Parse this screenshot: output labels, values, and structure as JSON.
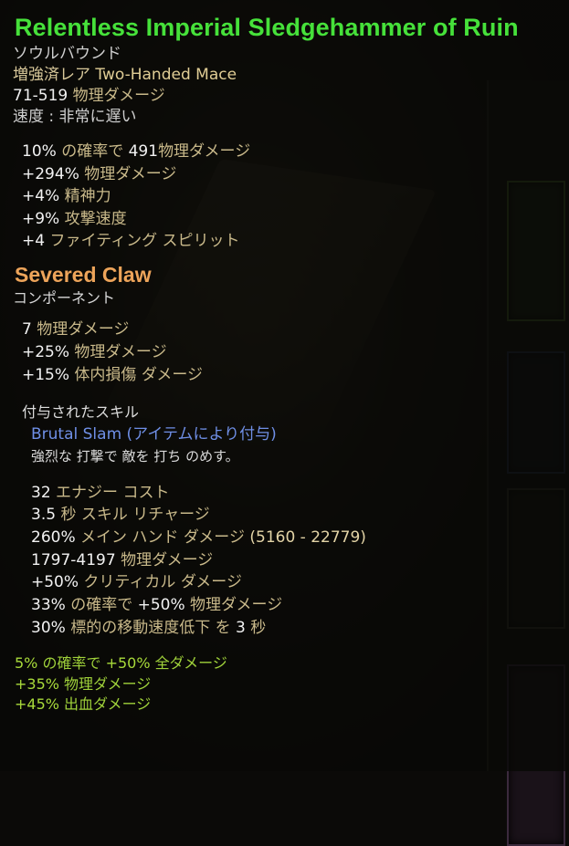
{
  "item": {
    "name": "Relentless Imperial Sledgehammer of Ruin",
    "binding": "ソウルバウンド",
    "type_prefix": "増強済レア",
    "type": "Two-Handed Mace",
    "damage_value": "71-519",
    "damage_label": "物理ダメージ",
    "speed": "速度 : 非常に遅い",
    "mods": [
      {
        "val": "10%",
        "pre": " の確率で ",
        "val2": "491",
        "lbl": "物理ダメージ"
      },
      {
        "val": "+294%",
        "lbl": " 物理ダメージ"
      },
      {
        "val": "+4%",
        "lbl": " 精神力"
      },
      {
        "val": "+9%",
        "lbl": " 攻撃速度"
      },
      {
        "val": "+4",
        "lbl": "  ファイティング スピリット"
      }
    ]
  },
  "component": {
    "name": "Severed Claw",
    "type": "コンポーネント",
    "mods": [
      {
        "val": "7",
        "lbl": " 物理ダメージ"
      },
      {
        "val": "+25%",
        "lbl": " 物理ダメージ"
      },
      {
        "val": "+15%",
        "lbl": " 体内損傷 ダメージ"
      }
    ]
  },
  "skill": {
    "header": "付与されたスキル",
    "name": "Brutal Slam (アイテムにより付与)",
    "description": "強烈な 打撃で 敵を 打ち のめす。",
    "stats": [
      {
        "val": "32",
        "lbl": " エナジー コスト"
      },
      {
        "val": "3.5",
        "lbl": " 秒 スキル リチャージ"
      },
      {
        "val": "260%",
        "lbl": " メイン ハンド ダメージ ",
        "val2": "(5160 - 22779)"
      },
      {
        "val": "1797-4197",
        "lbl": " 物理ダメージ"
      },
      {
        "val": "+50%",
        "lbl": " クリティカル ダメージ"
      },
      {
        "val": "33%",
        "lbl": " の確率で ",
        "val2": "+50%",
        "lbl2": " 物理ダメージ"
      },
      {
        "val": "30%",
        "lbl": " 標的の移動速度低下 を ",
        "val2": "3",
        "lbl2": " 秒"
      }
    ]
  },
  "set_bonus": [
    {
      "val": "5%",
      "lbl": " の確率で ",
      "val2": "+50%",
      "lbl2": " 全ダメージ"
    },
    {
      "val": "+35%",
      "lbl": " 物理ダメージ"
    },
    {
      "val": "+45%",
      "lbl": " 出血ダメージ"
    }
  ],
  "colors": {
    "item_name": "#46e13a",
    "component_name": "#eda45a",
    "skill_name": "#6f8fe6",
    "bonus_text": "#9fd13a"
  }
}
